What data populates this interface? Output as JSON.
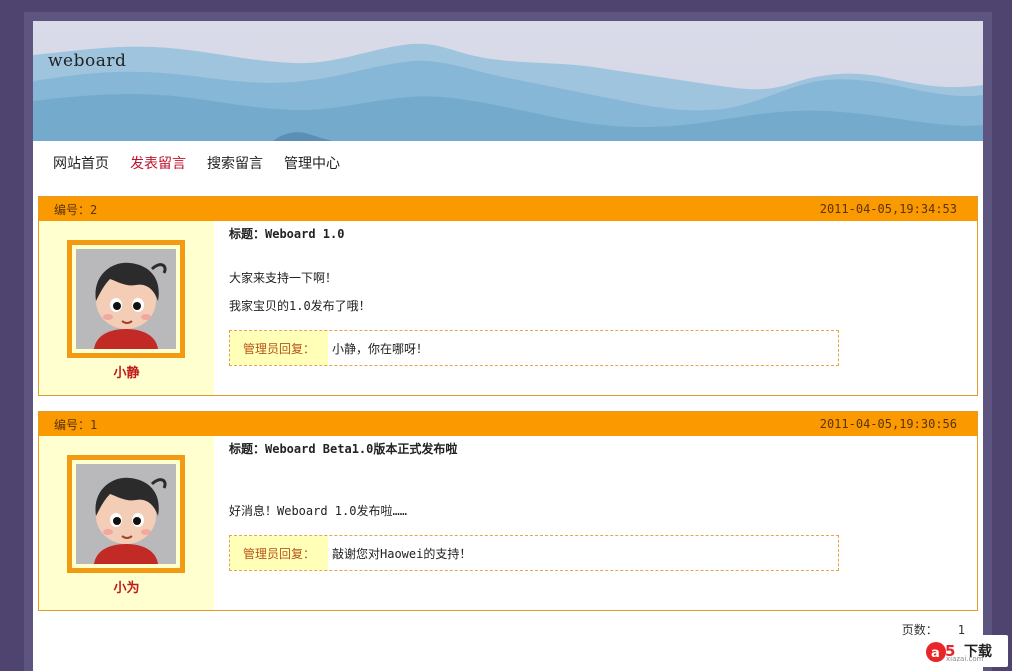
{
  "site": {
    "title": "weboard"
  },
  "nav": {
    "items": [
      {
        "label": "网站首页",
        "active": false
      },
      {
        "label": "发表留言",
        "active": true
      },
      {
        "label": "搜索留言",
        "active": false
      },
      {
        "label": "管理中心",
        "active": false
      }
    ]
  },
  "posts": [
    {
      "number_label": "编号：2",
      "datetime": "2011-04-05,19:34:53",
      "author": "小静",
      "title": "标题：Weboard 1.0",
      "lines": [
        "大家来支持一下啊！",
        "我家宝贝的1.0发布了哦！"
      ],
      "reply_label": "管理员回复：",
      "reply_text": "小静，你在哪呀！"
    },
    {
      "number_label": "编号：1",
      "datetime": "2011-04-05,19:30:56",
      "author": "小为",
      "title": "标题：Weboard Beta1.0版本正式发布啦",
      "lines": [
        "好消息！Weboard 1.0发布啦……"
      ],
      "reply_label": "管理员回复：",
      "reply_text": "敲谢您对Haowei的支持！"
    }
  ],
  "pager": {
    "label": "页数：",
    "current": "1"
  },
  "watermark": {
    "text": "下载",
    "sub": "xiazai.com"
  },
  "colors": {
    "accent": "#fb9a00",
    "nav_active": "#c0122d",
    "author": "#c01a1a",
    "sidebar_bg": "#ffffd0"
  }
}
